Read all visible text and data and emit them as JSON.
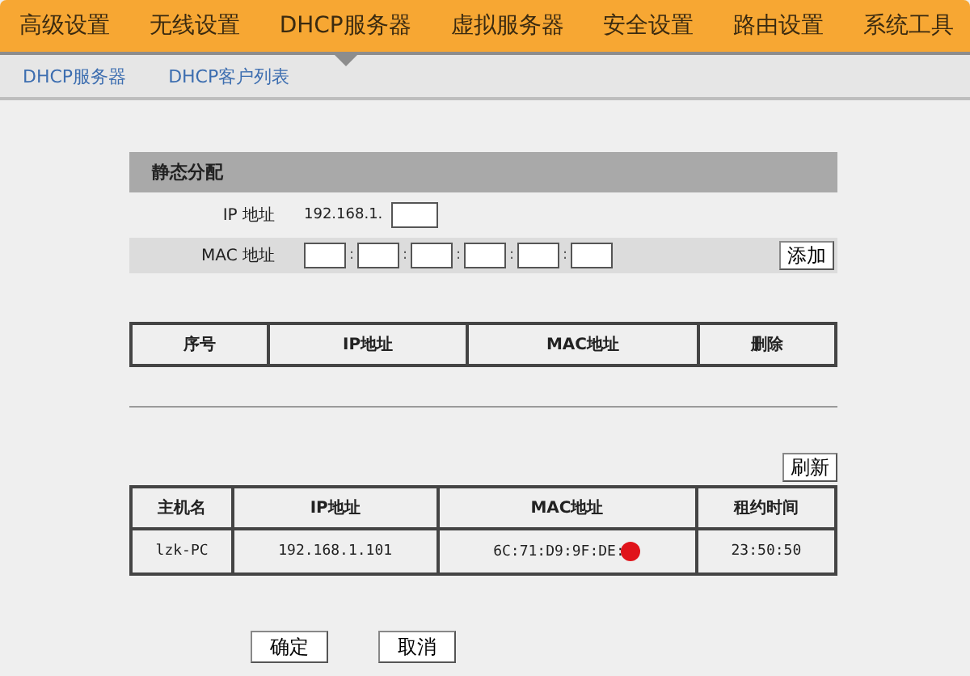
{
  "nav": [
    {
      "label": "高级设置",
      "selected": false
    },
    {
      "label": "无线设置",
      "selected": false
    },
    {
      "label": "DHCP服务器",
      "selected": true
    },
    {
      "label": "虚拟服务器",
      "selected": false
    },
    {
      "label": "安全设置",
      "selected": false
    },
    {
      "label": "路由设置",
      "selected": false
    },
    {
      "label": "系统工具",
      "selected": false
    }
  ],
  "subnav": [
    "DHCP服务器",
    "DHCP客户列表"
  ],
  "static": {
    "title": "静态分配",
    "ip_label": "IP 地址",
    "ip_prefix": "192.168.1.",
    "mac_label": "MAC 地址",
    "mac_separator": ":",
    "add_button": "添加"
  },
  "static_table": {
    "columns": [
      "序号",
      "IP地址",
      "MAC地址",
      "删除"
    ]
  },
  "refresh_button": "刷新",
  "clients_table": {
    "columns": [
      "主机名",
      "IP地址",
      "MAC地址",
      "租约时间"
    ],
    "rows": [
      {
        "cells": [
          "lzk-PC",
          "192.168.1.101",
          "6C:71:D9:9F:DE:",
          "23:50:50"
        ],
        "redacted": true
      }
    ]
  },
  "buttons": [
    "确定",
    "取消"
  ]
}
